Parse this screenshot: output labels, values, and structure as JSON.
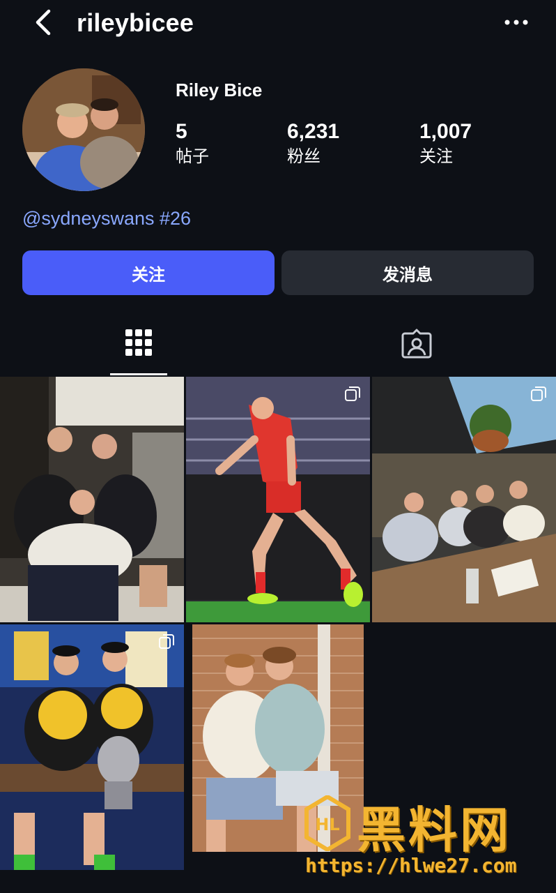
{
  "header": {
    "username": "rileybicee"
  },
  "profile": {
    "display_name": "Riley Bice",
    "stats": [
      {
        "value": "5",
        "label": "帖子"
      },
      {
        "value": "6,231",
        "label": "粉丝"
      },
      {
        "value": "1,007",
        "label": "关注"
      }
    ],
    "bio": "@sydneyswans #26"
  },
  "actions": {
    "follow_label": "关注",
    "message_label": "发消息"
  },
  "tabs": [
    {
      "icon": "grid-icon",
      "active": true
    },
    {
      "icon": "tagged-person-icon",
      "active": false
    }
  ],
  "colors": {
    "background": "#0d1016",
    "accent": "#4a5df9",
    "secondary_button": "#272b33",
    "link": "#8aa8ff"
  },
  "watermark": {
    "brand": "黑料网",
    "url": "https://hlwe27.com",
    "logo_letters": "HL"
  }
}
